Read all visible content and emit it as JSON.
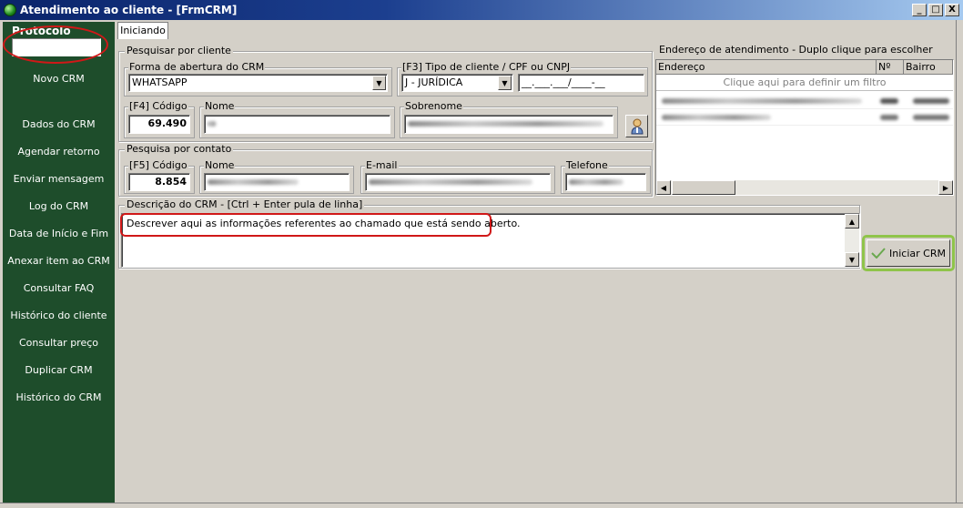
{
  "window": {
    "title": "Atendimento ao cliente - [FrmCRM]",
    "min_btn": "_",
    "max_btn": "□",
    "close_btn": "X"
  },
  "sidebar": {
    "protocolo_label": "Protocolo",
    "protocolo_value": "",
    "items": [
      {
        "label": "Novo CRM"
      },
      {
        "label": "Dados do CRM"
      },
      {
        "label": "Agendar retorno"
      },
      {
        "label": "Enviar mensagem"
      },
      {
        "label": "Log do CRM"
      },
      {
        "label": "Data de Início e Fim"
      },
      {
        "label": "Anexar item ao CRM"
      },
      {
        "label": "Consultar FAQ"
      },
      {
        "label": "Histórico do cliente"
      },
      {
        "label": "Consultar preço"
      },
      {
        "label": "Duplicar CRM"
      },
      {
        "label": "Histórico do CRM"
      }
    ]
  },
  "tabs": [
    {
      "label": "Iniciando"
    }
  ],
  "search_client": {
    "group_title": "Pesquisar por cliente",
    "forma_label": "Forma de abertura do CRM",
    "forma_value": "WHATSAPP",
    "tipo_label": "[F3]  Tipo de cliente / CPF ou CNPJ",
    "tipo_value": "J - JURÍDICA",
    "cnpj_value": "__.___.___/____-__",
    "codigo_label": "[F4] Código",
    "codigo_value": "69.490",
    "nome_label": "Nome",
    "sobrenome_label": "Sobrenome"
  },
  "search_contact": {
    "group_title": "Pesquisa por contato",
    "codigo_label": "[F5] Código",
    "codigo_value": "8.854",
    "nome_label": "Nome",
    "email_label": "E-mail",
    "telefone_label": "Telefone"
  },
  "address": {
    "group_title": "Endereço de atendimento - Duplo clique para escolher",
    "columns": [
      "Endereço",
      "Nº",
      "Bairro"
    ],
    "filter_text": "Clique aqui para definir um filtro"
  },
  "description": {
    "group_title": "Descrição do CRM - [Ctrl + Enter pula de linha]",
    "text": "Descrever aqui as informações referentes ao chamado que está sendo aberto."
  },
  "actions": {
    "iniciar_label": "Iniciar CRM"
  },
  "colors": {
    "sidebar_bg": "#1e4d2b",
    "highlight_red": "#d01818",
    "highlight_green": "#8fc44a",
    "titlebar": "#0a246a"
  }
}
